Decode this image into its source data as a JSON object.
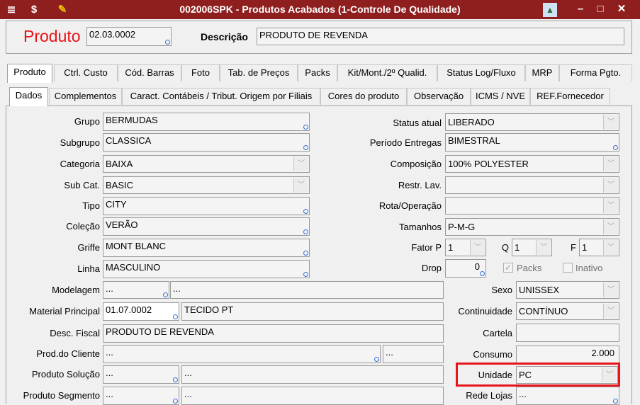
{
  "window": {
    "title": "002006SPK - Produtos Acabados (1-Controle De Qualidade)"
  },
  "header": {
    "produto_label": "Produto",
    "produto_value": "02.03.0002",
    "descricao_label": "Descrição",
    "descricao_value": "PRODUTO DE REVENDA"
  },
  "main_tabs": [
    "Produto",
    "Ctrl. Custo",
    "Cód. Barras",
    "Foto",
    "Tab. de Preços",
    "Packs",
    "Kit/Mont./2º Qualid.",
    "Status Log/Fluxo",
    "MRP",
    "Forma Pgto."
  ],
  "sub_tabs": [
    "Dados",
    "Complementos",
    "Caract. Contábeis / Tribut. Origem por Filiais",
    "Cores do produto",
    "Observação",
    "ICMS / NVE",
    "REF.Fornecedor"
  ],
  "left": {
    "grupo": {
      "label": "Grupo",
      "value": "BERMUDAS"
    },
    "subgrupo": {
      "label": "Subgrupo",
      "value": "CLASSICA"
    },
    "categoria": {
      "label": "Categoria",
      "value": "BAIXA"
    },
    "subcat": {
      "label": "Sub Cat.",
      "value": "BASIC"
    },
    "tipo": {
      "label": "Tipo",
      "value": "CITY"
    },
    "colecao": {
      "label": "Coleção",
      "value": "VERÃO"
    },
    "griffe": {
      "label": "Griffe",
      "value": "MONT BLANC"
    },
    "linha": {
      "label": "Linha",
      "value": "MASCULINO"
    },
    "modelagem": {
      "label": "Modelagem",
      "value1": "...",
      "value2": "..."
    },
    "material": {
      "label": "Material Principal",
      "code": "01.07.0002",
      "desc": "TECIDO PT"
    },
    "descfiscal": {
      "label": "Desc. Fiscal",
      "value": "PRODUTO DE REVENDA"
    },
    "prodcliente": {
      "label": "Prod.do Cliente",
      "value1": "...",
      "value2": "..."
    },
    "prodsolucao": {
      "label": "Produto Solução",
      "value1": "...",
      "value2": "..."
    },
    "prodsegmento": {
      "label": "Produto Segmento",
      "value1": "...",
      "value2": "..."
    }
  },
  "right": {
    "status": {
      "label": "Status atual",
      "value": "LIBERADO"
    },
    "periodo": {
      "label": "Período Entregas",
      "value": "BIMESTRAL"
    },
    "composicao": {
      "label": "Composição",
      "value": "100% POLYESTER"
    },
    "restr": {
      "label": "Restr. Lav.",
      "value": ""
    },
    "rota": {
      "label": "Rota/Operação",
      "value": ""
    },
    "tamanhos": {
      "label": "Tamanhos",
      "value": "P-M-G"
    },
    "fatorp": {
      "label": "Fator P",
      "value": "1"
    },
    "q": {
      "label": "Q",
      "value": "1"
    },
    "f": {
      "label": "F",
      "value": "1"
    },
    "drop": {
      "label": "Drop",
      "value": "0"
    },
    "packs": {
      "label": "Packs",
      "checked": true
    },
    "inativo": {
      "label": "Inativo",
      "checked": false
    },
    "sexo": {
      "label": "Sexo",
      "value": "UNISSEX"
    },
    "continuidade": {
      "label": "Continuidade",
      "value": "CONTÍNUO"
    },
    "cartela": {
      "label": "Cartela",
      "value": ""
    },
    "consumo": {
      "label": "Consumo",
      "value": "2.000"
    },
    "unidade": {
      "label": "Unidade",
      "value": "PC"
    },
    "redelojas": {
      "label": "Rede Lojas",
      "value": "..."
    }
  },
  "colors": {
    "titlebar": "#8f1f1f",
    "produto_label": "#e8141a",
    "highlight": "#e8141a",
    "lookup_icon": "#3a6fd8"
  }
}
